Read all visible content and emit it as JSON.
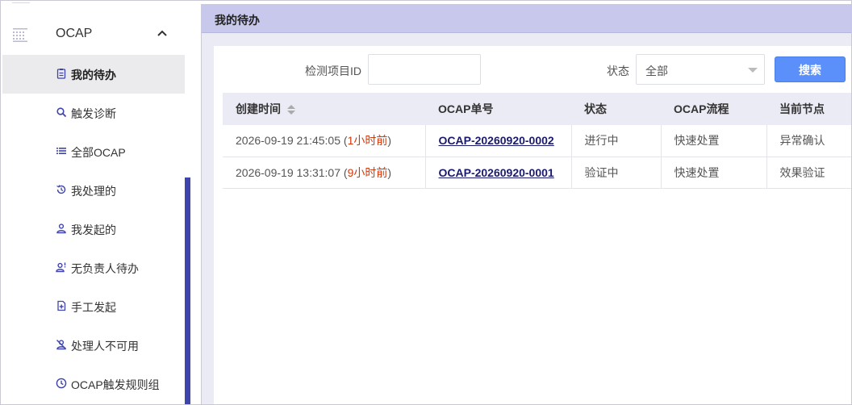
{
  "sidebar": {
    "group_label": "OCAP",
    "items": [
      {
        "label": "我的待办",
        "icon": "clipboard-icon",
        "active": true
      },
      {
        "label": "触发诊断",
        "icon": "search-icon"
      },
      {
        "label": "全部OCAP",
        "icon": "list-icon"
      },
      {
        "label": "我处理的",
        "icon": "history-icon"
      },
      {
        "label": "我发起的",
        "icon": "user-icon"
      },
      {
        "label": "无负责人待办",
        "icon": "user-unassigned-icon"
      },
      {
        "label": "手工发起",
        "icon": "document-add-icon"
      },
      {
        "label": "处理人不可用",
        "icon": "user-disabled-icon"
      },
      {
        "label": "OCAP触发规则组",
        "icon": "clock-icon"
      }
    ]
  },
  "panel": {
    "title": "我的待办"
  },
  "filters": {
    "project_id_label": "检测项目ID",
    "project_id_value": "",
    "status_label": "状态",
    "status_value": "全部",
    "search_label": "搜索"
  },
  "table": {
    "headers": [
      "创建时间",
      "OCAP单号",
      "状态",
      "OCAP流程",
      "当前节点"
    ],
    "rows": [
      {
        "time": "2026-09-19 21:45:05",
        "open": " (",
        "ago": "1小时前",
        "close": ")",
        "ocap": "OCAP-20260920-0002",
        "status": "进行中",
        "flow": "快速处置",
        "node": "异常确认"
      },
      {
        "time": "2026-09-19 13:31:07",
        "open": " (",
        "ago": "9小时前",
        "close": ")",
        "ocap": "OCAP-20260920-0001",
        "status": "验证中",
        "flow": "快速处置",
        "node": "效果验证"
      }
    ]
  },
  "colors": {
    "accent": "#3f44ad",
    "header_bg": "#c7c8ec",
    "search_button": "#5b8ff9",
    "time_ago": "#d4380d",
    "link": "#1a1a6e"
  }
}
